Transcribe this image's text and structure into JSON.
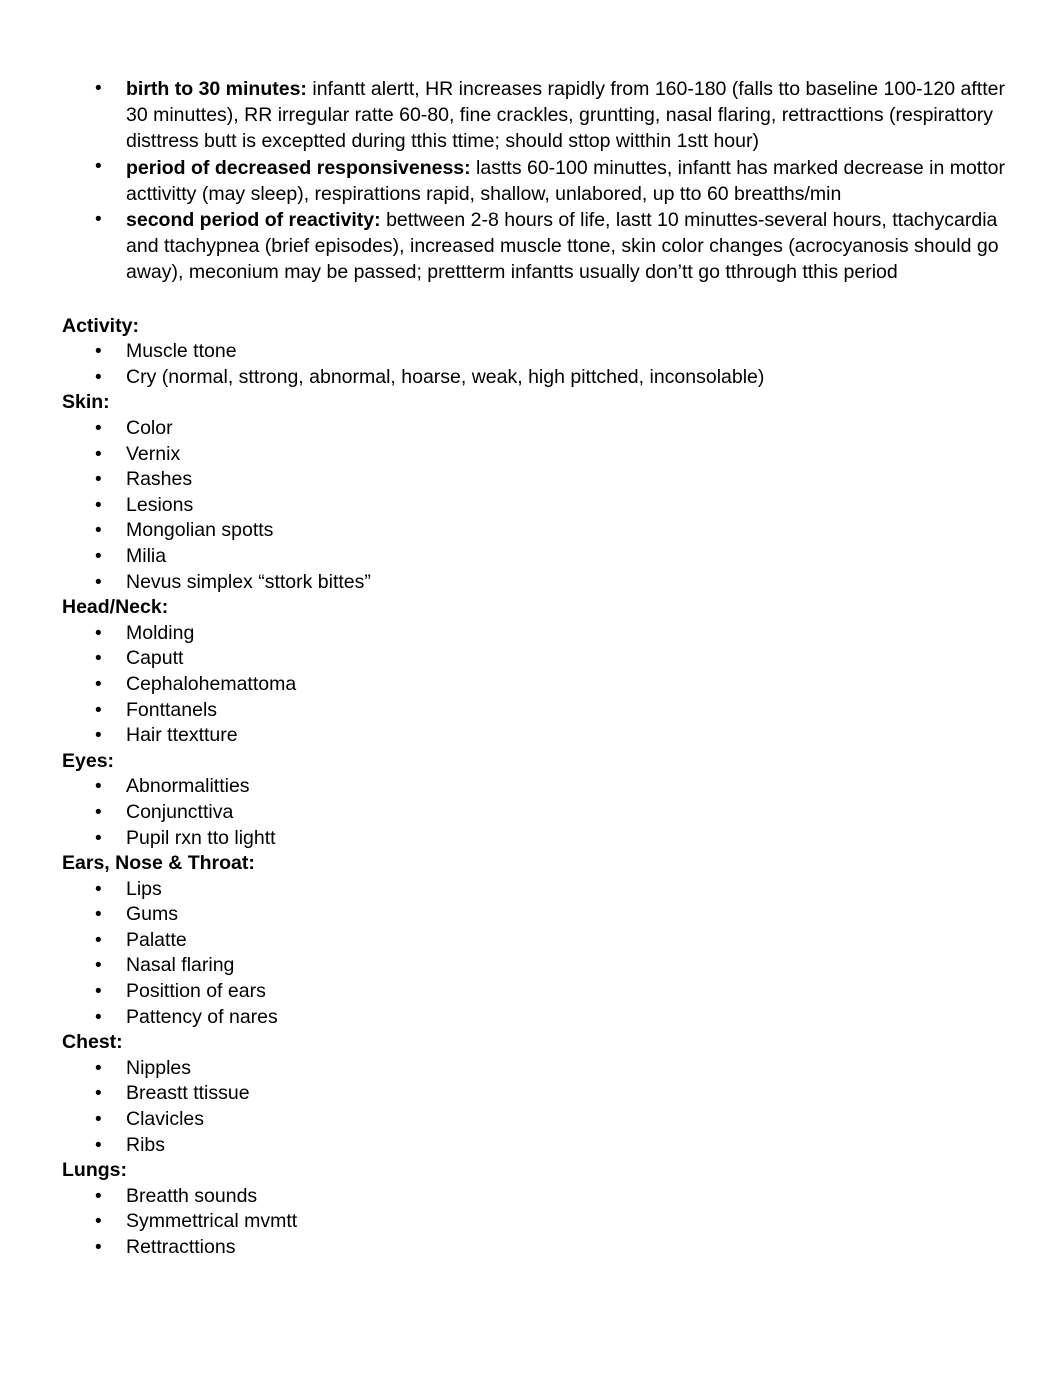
{
  "document": {
    "intro_bullets": [
      {
        "lead": "birth to 30 minutes:",
        "body": " infantt alertt, HR increases rapidly from 160-180 (falls tto baseline 100-120 aftter 30 minuttes), RR irregular ratte 60-80, fine crackles, gruntting, nasal flaring, rettracttions (respirattory disttress butt is exceptted during tthis ttime; should sttop witthin 1stt hour)"
      },
      {
        "lead": "period of decreased responsiveness:",
        "body": " lastts 60-100 minuttes, infantt has marked decrease in mottor acttivitty (may sleep), respirattions rapid, shallow, unlabored, up tto 60 breatths/min"
      },
      {
        "lead": "second period of reactivity:",
        "body": " bettween 2-8 hours of life, lastt 10 minuttes-several hours, ttachycardia and ttachypnea (brief episodes), increased muscle ttone, skin color changes (acrocyanosis should go away), meconium may be passed; prettterm infantts usually don’tt go tthrough tthis period"
      }
    ],
    "sections": [
      {
        "heading": "Activity:",
        "items": [
          "Muscle ttone",
          "Cry (normal, sttrong, abnormal, hoarse, weak, high pittched, inconsolable)"
        ]
      },
      {
        "heading": "Skin:",
        "items": [
          "Color",
          "Vernix",
          "Rashes",
          "Lesions",
          "Mongolian spotts",
          "Milia",
          "Nevus simplex “sttork bittes”"
        ]
      },
      {
        "heading": "Head/Neck:",
        "items": [
          "Molding",
          "Caputt",
          "Cephalohemattoma",
          "Fonttanels",
          "Hair ttextture"
        ]
      },
      {
        "heading": "Eyes:",
        "items": [
          "Abnormalitties",
          "Conjuncttiva",
          "Pupil rxn tto lightt"
        ]
      },
      {
        "heading": "Ears, Nose & Throat:",
        "items": [
          "Lips",
          "Gums",
          "Palatte",
          "Nasal flaring",
          "Posittion of ears",
          "Pattency of nares"
        ]
      },
      {
        "heading": "Chest:",
        "items": [
          "Nipples",
          "Breastt ttissue",
          "Clavicles",
          "Ribs"
        ]
      },
      {
        "heading": "Lungs:",
        "items": [
          "Breatth sounds",
          "Symmettrical mvmtt",
          "Rettracttions"
        ]
      }
    ]
  }
}
